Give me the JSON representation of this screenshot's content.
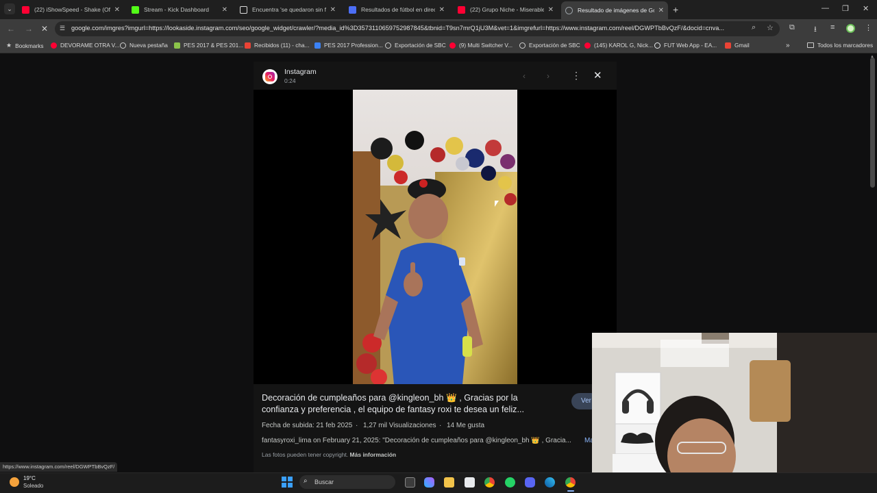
{
  "tabs": [
    {
      "title": "(22) iShowSpeed - Shake (Offic",
      "favicon": "youtube-icon",
      "color": "#ff0033"
    },
    {
      "title": "Stream - Kick Dashboard",
      "favicon": "kick-icon",
      "color": "#53fc18"
    },
    {
      "title": "Encuentra 'se quedaron sin flo",
      "favicon": "tiktok-icon",
      "color": "#ffffff"
    },
    {
      "title": "Resultados de fútbol en directo",
      "favicon": "scores-icon",
      "color": "#4c6ef5"
    },
    {
      "title": "(22) Grupo Niche - Miserable (",
      "favicon": "youtube-icon",
      "color": "#ff0033"
    },
    {
      "title": "Resultado de imágenes de Goo",
      "favicon": "google-icon",
      "color": "#9aa0a6"
    }
  ],
  "address_bar": {
    "url": "google.com/imgres?imgurl=https://lookaside.instagram.com/seo/google_widget/crawler/?media_id%3D3573110659752987845&tbnid=T9sn7mrQ1jU3M&vet=1&imgrefurl=https://www.instagram.com/reel/DGWPTbBvQzF/&docid=cnva..."
  },
  "bookmarks": [
    {
      "label": "Bookmarks",
      "icon": "star-icon",
      "color": "#cfcfcf"
    },
    {
      "label": "DEVORAME OTRA V...",
      "icon": "youtube-icon",
      "color": "#ff0033"
    },
    {
      "label": "Nueva pestaña",
      "icon": "globe-icon",
      "color": "#9aa0a6"
    },
    {
      "label": "PES 2017 & PES 201...",
      "icon": "pes-icon",
      "color": "#8bc34a"
    },
    {
      "label": "Recibidos (11) - cha...",
      "icon": "gmail-icon",
      "color": "#ea4335"
    },
    {
      "label": "PES 2017 Profession...",
      "icon": "pes-icon",
      "color": "#3b82f6"
    },
    {
      "label": "Exportación de SBC",
      "icon": "globe-icon",
      "color": "#9aa0a6"
    },
    {
      "label": "(9) Multi Switcher V...",
      "icon": "youtube-icon",
      "color": "#ff0033"
    },
    {
      "label": "Exportación de SBC",
      "icon": "globe-icon",
      "color": "#9aa0a6"
    },
    {
      "label": "(145) KAROL G, Nick...",
      "icon": "youtube-icon",
      "color": "#ff0033"
    },
    {
      "label": "FUT Web App - EA...",
      "icon": "ea-icon",
      "color": "#e8eaed"
    },
    {
      "label": "Gmail",
      "icon": "gmail-icon",
      "color": "#ea4335"
    }
  ],
  "bookmarks_folder": "Todos los marcadores",
  "viewer": {
    "source_name": "Instagram",
    "duration": "0:24",
    "caption": "Decoración de cumpleaños para @kingleon_bh 👑 , Gracias por la confianza y preferencia , el equipo de fantasy roxi te desea un feliz...",
    "upload_date": "Fecha de subida: 21 feb 2025",
    "views": "1,27 mil Visualizaciones",
    "likes": "14 Me gusta",
    "post_line": "fantasyroxi_lima on February 21, 2025: \"Decoración de cumpleaños para @kingleon_bh 👑 , Gracia...",
    "more": "Ma",
    "copyright": "Las fotos pueden tener copyright.",
    "more_info": "Más información",
    "visit_button": "Ver"
  },
  "status_link": "https://www.instagram.com/reel/DGWPTbBvQzF/",
  "taskbar": {
    "temperature": "19°C",
    "weather": "Soleado",
    "search_label": "Buscar"
  }
}
